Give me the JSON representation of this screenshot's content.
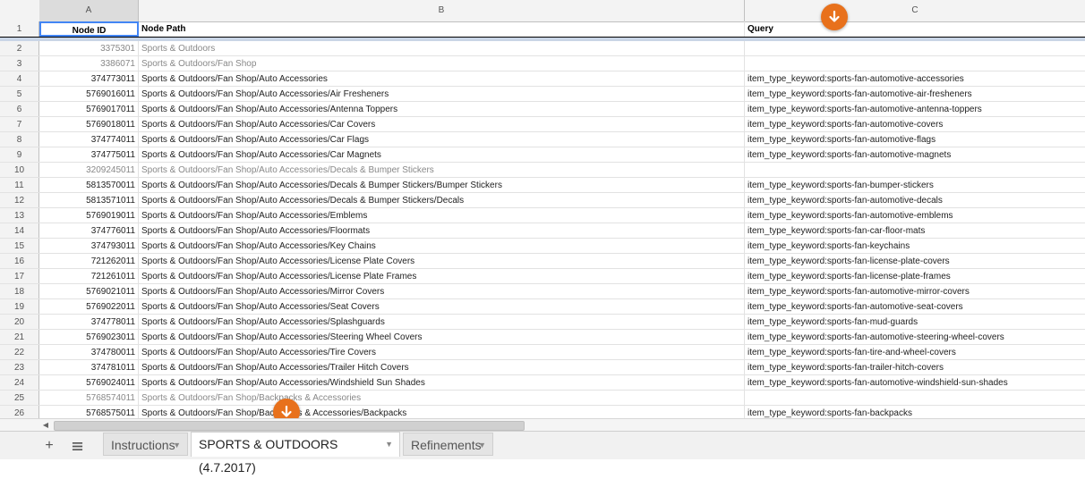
{
  "columns": [
    "A",
    "B",
    "C"
  ],
  "header": {
    "num": "1",
    "a": "Node ID",
    "b": "Node Path",
    "c": "Query"
  },
  "rows": [
    {
      "num": "2",
      "a": "3375301",
      "b": "Sports & Outdoors",
      "c": "",
      "gray": true
    },
    {
      "num": "3",
      "a": "3386071",
      "b": "Sports & Outdoors/Fan Shop",
      "c": "",
      "gray": true
    },
    {
      "num": "4",
      "a": "374773011",
      "b": "Sports & Outdoors/Fan Shop/Auto Accessories",
      "c": "item_type_keyword:sports-fan-automotive-accessories"
    },
    {
      "num": "5",
      "a": "5769016011",
      "b": "Sports & Outdoors/Fan Shop/Auto Accessories/Air Fresheners",
      "c": "item_type_keyword:sports-fan-automotive-air-fresheners"
    },
    {
      "num": "6",
      "a": "5769017011",
      "b": "Sports & Outdoors/Fan Shop/Auto Accessories/Antenna Toppers",
      "c": "item_type_keyword:sports-fan-automotive-antenna-toppers"
    },
    {
      "num": "7",
      "a": "5769018011",
      "b": "Sports & Outdoors/Fan Shop/Auto Accessories/Car Covers",
      "c": "item_type_keyword:sports-fan-automotive-covers"
    },
    {
      "num": "8",
      "a": "374774011",
      "b": "Sports & Outdoors/Fan Shop/Auto Accessories/Car Flags",
      "c": "item_type_keyword:sports-fan-automotive-flags"
    },
    {
      "num": "9",
      "a": "374775011",
      "b": "Sports & Outdoors/Fan Shop/Auto Accessories/Car Magnets",
      "c": "item_type_keyword:sports-fan-automotive-magnets"
    },
    {
      "num": "10",
      "a": "3209245011",
      "b": "Sports & Outdoors/Fan Shop/Auto Accessories/Decals & Bumper Stickers",
      "c": "",
      "gray": true
    },
    {
      "num": "11",
      "a": "5813570011",
      "b": "Sports & Outdoors/Fan Shop/Auto Accessories/Decals & Bumper Stickers/Bumper Stickers",
      "c": "item_type_keyword:sports-fan-bumper-stickers"
    },
    {
      "num": "12",
      "a": "5813571011",
      "b": "Sports & Outdoors/Fan Shop/Auto Accessories/Decals & Bumper Stickers/Decals",
      "c": "item_type_keyword:sports-fan-automotive-decals"
    },
    {
      "num": "13",
      "a": "5769019011",
      "b": "Sports & Outdoors/Fan Shop/Auto Accessories/Emblems",
      "c": "item_type_keyword:sports-fan-automotive-emblems"
    },
    {
      "num": "14",
      "a": "374776011",
      "b": "Sports & Outdoors/Fan Shop/Auto Accessories/Floormats",
      "c": "item_type_keyword:sports-fan-car-floor-mats"
    },
    {
      "num": "15",
      "a": "374793011",
      "b": "Sports & Outdoors/Fan Shop/Auto Accessories/Key Chains",
      "c": "item_type_keyword:sports-fan-keychains"
    },
    {
      "num": "16",
      "a": "721262011",
      "b": "Sports & Outdoors/Fan Shop/Auto Accessories/License Plate Covers",
      "c": "item_type_keyword:sports-fan-license-plate-covers"
    },
    {
      "num": "17",
      "a": "721261011",
      "b": "Sports & Outdoors/Fan Shop/Auto Accessories/License Plate Frames",
      "c": "item_type_keyword:sports-fan-license-plate-frames"
    },
    {
      "num": "18",
      "a": "5769021011",
      "b": "Sports & Outdoors/Fan Shop/Auto Accessories/Mirror Covers",
      "c": "item_type_keyword:sports-fan-automotive-mirror-covers"
    },
    {
      "num": "19",
      "a": "5769022011",
      "b": "Sports & Outdoors/Fan Shop/Auto Accessories/Seat Covers",
      "c": "item_type_keyword:sports-fan-automotive-seat-covers"
    },
    {
      "num": "20",
      "a": "374778011",
      "b": "Sports & Outdoors/Fan Shop/Auto Accessories/Splashguards",
      "c": "item_type_keyword:sports-fan-mud-guards"
    },
    {
      "num": "21",
      "a": "5769023011",
      "b": "Sports & Outdoors/Fan Shop/Auto Accessories/Steering Wheel Covers",
      "c": "item_type_keyword:sports-fan-automotive-steering-wheel-covers"
    },
    {
      "num": "22",
      "a": "374780011",
      "b": "Sports & Outdoors/Fan Shop/Auto Accessories/Tire Covers",
      "c": "item_type_keyword:sports-fan-tire-and-wheel-covers"
    },
    {
      "num": "23",
      "a": "374781011",
      "b": "Sports & Outdoors/Fan Shop/Auto Accessories/Trailer Hitch Covers",
      "c": "item_type_keyword:sports-fan-trailer-hitch-covers"
    },
    {
      "num": "24",
      "a": "5769024011",
      "b": "Sports & Outdoors/Fan Shop/Auto Accessories/Windshield Sun Shades",
      "c": "item_type_keyword:sports-fan-automotive-windshield-sun-shades"
    },
    {
      "num": "25",
      "a": "5768574011",
      "b": "Sports & Outdoors/Fan Shop/Backpacks & Accessories",
      "c": "",
      "gray": true
    },
    {
      "num": "26",
      "a": "5768575011",
      "b": "Sports & Outdoors/Fan Shop/Backpacks & Accessories/Backpacks",
      "c": "item_type_keyword:sports-fan-backpacks"
    }
  ],
  "tabs": [
    {
      "label": "Instructions",
      "active": false
    },
    {
      "label": "SPORTS & OUTDOORS (4.7.2017)",
      "active": true
    },
    {
      "label": "Refinements",
      "active": false
    }
  ],
  "icons": {
    "add": "plus-icon",
    "sheets_list": "menu-icon",
    "fab": "arrow-down-icon"
  },
  "colors": {
    "fab": "#e8711c",
    "selection": "#4285f4"
  }
}
